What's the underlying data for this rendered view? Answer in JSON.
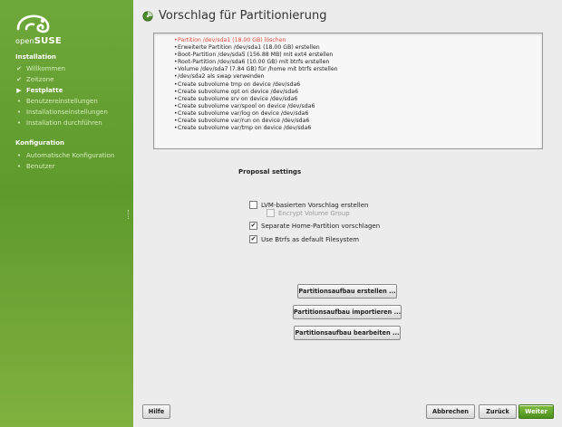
{
  "sidebar": {
    "logo": {
      "prefix": "open",
      "brand": "SUSE",
      "icon": "chameleon-logo-icon"
    },
    "sections": [
      {
        "label": "Installation",
        "items": [
          {
            "label": "Willkommen",
            "state": "done"
          },
          {
            "label": "Zeitzone",
            "state": "done"
          },
          {
            "label": "Festplatte",
            "state": "active"
          },
          {
            "label": "Benutzereinstellungen",
            "state": "pending"
          },
          {
            "label": "Installationseinstellungen",
            "state": "pending"
          },
          {
            "label": "Installation durchführen",
            "state": "pending"
          }
        ]
      },
      {
        "label": "Konfiguration",
        "items": [
          {
            "label": "Automatische Konfiguration",
            "state": "pending"
          },
          {
            "label": "Benutzer",
            "state": "pending"
          }
        ]
      }
    ]
  },
  "main": {
    "title": "Vorschlag für Partitionierung",
    "proposal_items": [
      "Partition /dev/sda1 (18.00 GB) löschen",
      "Erweiterte Partition /dev/sda1 (18.00 GB) erstellen",
      "Boot-Partition /dev/sda5 (156.88 MB) mit ext4 erstellen",
      "Root-Partition /dev/sda6 (10.00 GB) mit btrfs erstellen",
      "Volume /dev/sda7 (7.84 GB) für /home mit btrfs erstellen",
      "/dev/sda2 als swap verwenden",
      "Create subvolume tmp on device /dev/sda6",
      "Create subvolume opt on device /dev/sda6",
      "Create subvolume srv on device /dev/sda6",
      "Create subvolume var/spool on device /dev/sda6",
      "Create subvolume var/log on device /dev/sda6",
      "Create subvolume var/run on device /dev/sda6",
      "Create subvolume var/tmp on device /dev/sda6"
    ],
    "proposal_settings": {
      "title": "Proposal settings",
      "lvm": {
        "label": "LVM-basierten Vorschlag erstellen",
        "checked": false
      },
      "encrypt": {
        "label": "Encrypt Volume Group",
        "checked": false,
        "disabled": true
      },
      "home": {
        "label": "Separate Home-Partition vorschlagen",
        "checked": true
      },
      "btrfs": {
        "label": "Use Btrfs as default Filesystem",
        "checked": true
      }
    },
    "buttons": {
      "create": "Partitionsaufbau erstellen ...",
      "import": "Partitionsaufbau importieren ...",
      "edit": "Partitionsaufbau bearbeiten ..."
    }
  },
  "footer": {
    "help": "Hilfe",
    "abort": "Abbrechen",
    "back": "Zurück",
    "next": "Weiter"
  },
  "colors": {
    "sidebar": "#5f9a2c",
    "accent": "#4e8f1e",
    "delete": "#e24b3a"
  }
}
